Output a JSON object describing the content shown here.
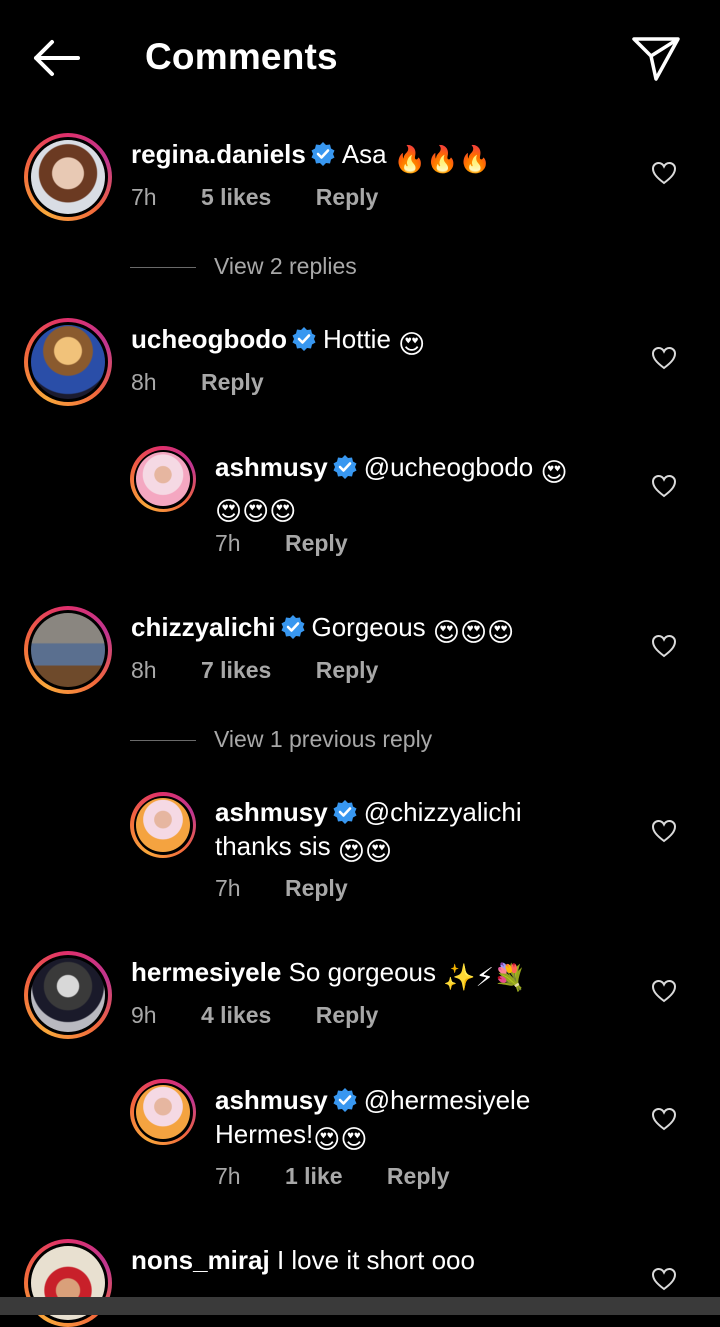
{
  "header": {
    "title": "Comments"
  },
  "comments": [
    {
      "username": "regina.daniels",
      "verified": true,
      "text": "Asa",
      "emoji": "🔥🔥🔥",
      "time": "7h",
      "likes": "5 likes",
      "reply": "Reply"
    },
    {
      "view_replies": "View 2 replies"
    },
    {
      "username": "ucheogbodo",
      "verified": true,
      "text": "Hottie",
      "emoji": "😍",
      "time": "8h",
      "reply": "Reply"
    },
    {
      "username": "ashmusy",
      "verified": true,
      "text": "@ucheogbodo",
      "emoji": "😍",
      "emoji2": "😍😍😍",
      "time": "7h",
      "reply": "Reply"
    },
    {
      "username": "chizzyalichi",
      "verified": true,
      "text": "Gorgeous",
      "emoji": "😍😍😍",
      "time": "8h",
      "likes": "7 likes",
      "reply": "Reply"
    },
    {
      "view_replies": "View 1 previous reply"
    },
    {
      "username": "ashmusy",
      "verified": true,
      "text": "@chizzyalichi",
      "text2": "thanks sis",
      "emoji": "😍😍",
      "time": "7h",
      "reply": "Reply"
    },
    {
      "username": "hermesiyele",
      "verified": false,
      "text": "So gorgeous",
      "emoji": "✨⚡💐",
      "time": "9h",
      "likes": "4 likes",
      "reply": "Reply"
    },
    {
      "username": "ashmusy",
      "verified": true,
      "text": "@hermesiyele",
      "text2": "Hermes!",
      "emoji": "😍😍",
      "time": "7h",
      "likes": "1 like",
      "reply": "Reply"
    },
    {
      "username": "nons_miraj",
      "verified": false,
      "text": "I love it short ooo"
    }
  ],
  "colors": {
    "background": "#000000",
    "verified": "#3897f0",
    "muted": "#a8a8a8"
  },
  "icons": [
    "back-arrow-icon",
    "send-icon",
    "verified-icon",
    "heart-icon"
  ]
}
